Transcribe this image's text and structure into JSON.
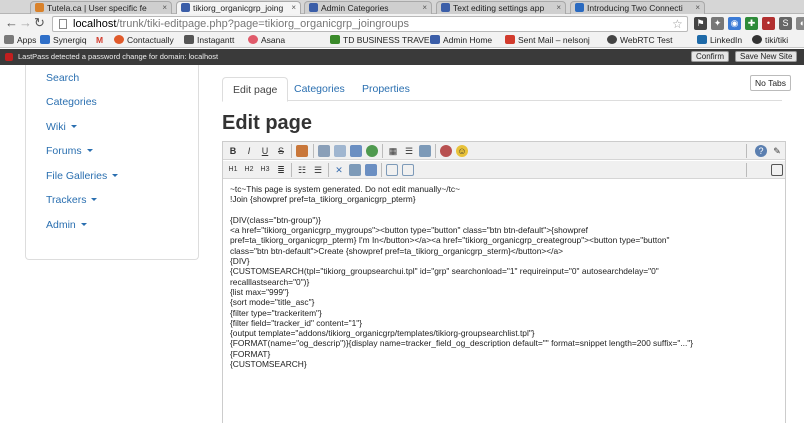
{
  "browser": {
    "tabs": [
      {
        "label": "Tutela.ca | User specific fe",
        "color": "#d9822b"
      },
      {
        "label": "tikiorg_organicgrp_joing",
        "color": "#3b5ea8",
        "active": true
      },
      {
        "label": "Admin Categories",
        "color": "#3b5ea8"
      },
      {
        "label": "Text editing settings app",
        "color": "#3b5ea8"
      },
      {
        "label": "Introducing Two Connecti",
        "color": "#2a6ac0"
      }
    ],
    "address": {
      "host": "localhost",
      "path": "/trunk/tiki-editpage.php?page=tikiorg_organicgrp_joingroups"
    },
    "bookmarks": [
      {
        "label": "Apps",
        "color": "#7a7a7a"
      },
      {
        "label": "Synergiq",
        "color": "#2f6fc8"
      },
      {
        "label": "M",
        "color": "#d23b2d"
      },
      {
        "label": "Contactually",
        "color": "#e05a2b"
      },
      {
        "label": "Instagantt",
        "color": "#555"
      },
      {
        "label": "Asana",
        "color": "#e05a6a"
      },
      {
        "label": "TD BUSINESS TRAVE",
        "color": "#3a8a2a"
      },
      {
        "label": "Admin Home",
        "color": "#3b5ea8"
      },
      {
        "label": "Sent Mail – nelsonj",
        "color": "#d23b2d"
      },
      {
        "label": "WebRTC Test",
        "color": "#444"
      },
      {
        "label": "LinkedIn",
        "color": "#1e6aa8"
      },
      {
        "label": "tiki/tiki",
        "color": "#333"
      }
    ],
    "lastpass": {
      "message": "LastPass detected a password change for domain: localhost",
      "confirm": "Confirm",
      "save_new": "Save New Site"
    }
  },
  "sidebar": {
    "items": [
      {
        "label": "Search"
      },
      {
        "label": "Categories"
      },
      {
        "label": "Wiki"
      },
      {
        "label": "Forums"
      },
      {
        "label": "File Galleries"
      },
      {
        "label": "Trackers"
      },
      {
        "label": "Admin"
      }
    ]
  },
  "page": {
    "notabs_label": "No Tabs",
    "tabs": [
      "Edit page",
      "Categories",
      "Properties"
    ],
    "title": "Edit page"
  },
  "editor": {
    "lines": [
      "~tc~This page is system generated. Do not edit manually~/tc~",
      "!Join {showpref pref=ta_tikiorg_organicgrp_pterm}",
      "",
      "{DIV(class=\"btn-group\")}",
      "<a href=\"tikiorg_organicgrp_mygroups\"><button type=\"button\" class=\"btn btn-default\">{showpref",
      "pref=ta_tikiorg_organicgrp_pterm} I'm In</button></a><a href=\"tikiorg_organicgrp_creategroup\"><button type=\"button\"",
      "class=\"btn btn-default\">Create {showpref pref=ta_tikiorg_organicgrp_sterm}</button></a>",
      "{DIV}",
      "{CUSTOMSEARCH(tpl=\"tikiorg_groupsearchui.tpl\" id=\"grp\" searchonload=\"1\" requireinput=\"0\" autosearchdelay=\"0\"",
      "recalllastsearch=\"0\")}",
      "  {list max=\"999\"}",
      "  {sort mode=\"title_asc\"}",
      "  {filter type=\"trackeritem\"}",
      "  {filter field=\"tracker_id\" content=\"1\"}",
      "  {output template=\"addons/tikiorg_organicgrp/templates/tikiorg-groupsearchlist.tpl\"}",
      "  {FORMAT(name=\"og_descrip\")}{display name=tracker_field_og_description default=\"\" format=snippet length=200 suffix=\"...\"}",
      "{FORMAT}",
      "{CUSTOMSEARCH}"
    ]
  }
}
